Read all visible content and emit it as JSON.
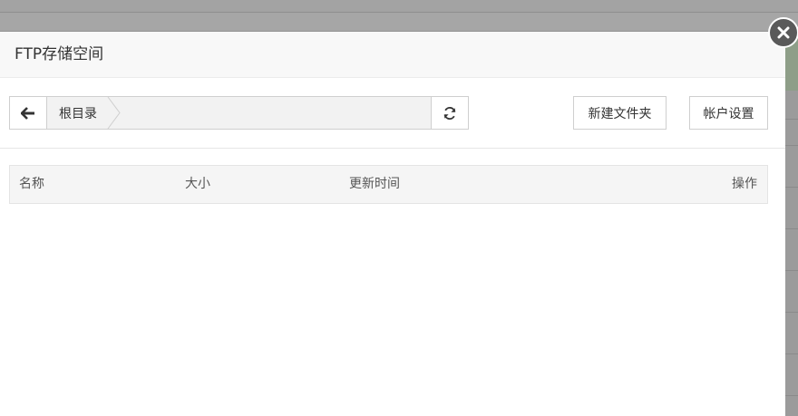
{
  "dialog": {
    "title": "FTP存储空间"
  },
  "toolbar": {
    "breadcrumb_root": "根目录",
    "new_folder_label": "新建文件夹",
    "account_settings_label": "帐户设置"
  },
  "table": {
    "columns": [
      "名称",
      "大小",
      "更新时间",
      "操作"
    ],
    "rows": []
  },
  "icons": {
    "close": "close-icon",
    "back": "arrow-left-icon",
    "refresh": "refresh-icon"
  }
}
